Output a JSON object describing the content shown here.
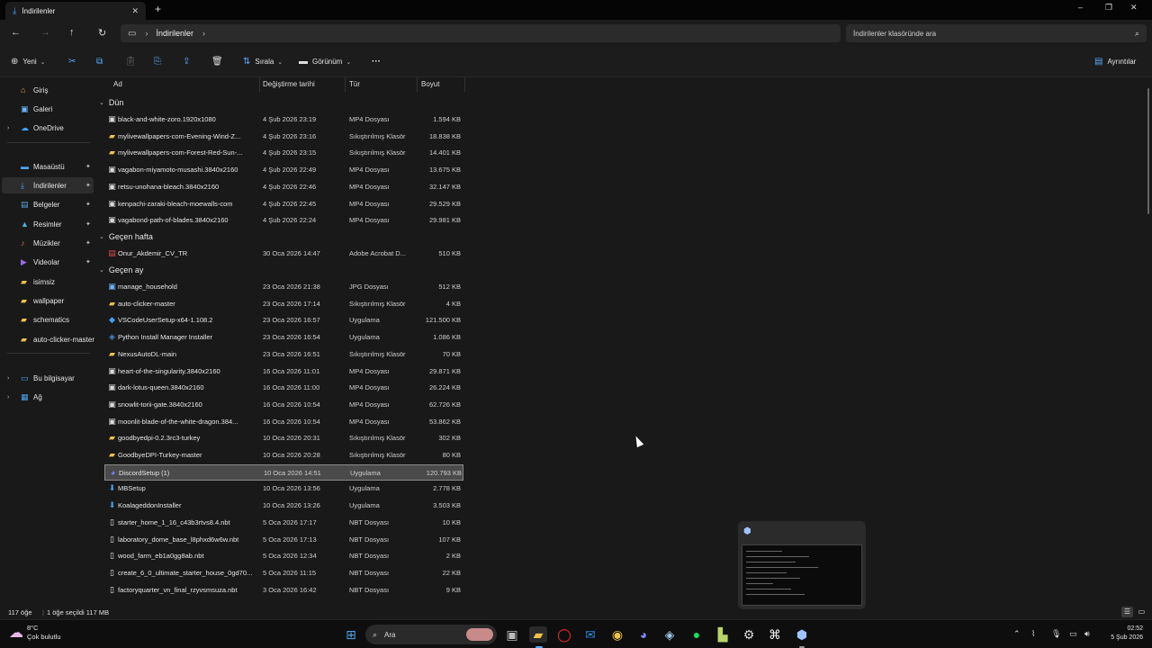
{
  "window": {
    "tab_title": "İndirilenler",
    "new_tab": "+",
    "controls": [
      "–",
      "❐",
      "✕"
    ]
  },
  "address": {
    "breadcrumbs": [
      "İndirilenler"
    ],
    "search_placeholder": "İndirilenler klasöründe ara"
  },
  "commands": {
    "new": "Yeni",
    "sort": "Sırala",
    "view": "Görünüm",
    "more": "···",
    "details": "Ayrıntılar"
  },
  "sidebar": {
    "items": [
      {
        "label": "Giriş",
        "icon": "home-icon",
        "expandable": false,
        "pinned": false
      },
      {
        "label": "Galeri",
        "icon": "gallery-icon",
        "expandable": false,
        "pinned": false
      },
      {
        "label": "OneDrive",
        "icon": "cloud-icon",
        "expandable": true,
        "pinned": false
      },
      {
        "label": "Masaüstü",
        "icon": "desktop-icon",
        "expandable": false,
        "pinned": true
      },
      {
        "label": "İndirilenler",
        "icon": "download-icon",
        "expandable": false,
        "pinned": true,
        "active": true
      },
      {
        "label": "Belgeler",
        "icon": "documents-icon",
        "expandable": false,
        "pinned": true
      },
      {
        "label": "Resimler",
        "icon": "pictures-icon",
        "expandable": false,
        "pinned": true
      },
      {
        "label": "Müzikler",
        "icon": "music-icon",
        "expandable": false,
        "pinned": true
      },
      {
        "label": "Videolar",
        "icon": "videos-icon",
        "expandable": false,
        "pinned": true
      },
      {
        "label": "isimsiz",
        "icon": "folder-icon",
        "expandable": false,
        "pinned": false
      },
      {
        "label": "wallpaper",
        "icon": "folder-icon",
        "expandable": false,
        "pinned": false
      },
      {
        "label": "schematics",
        "icon": "folder-icon",
        "expandable": false,
        "pinned": false
      },
      {
        "label": "auto-clicker-master",
        "icon": "folder-icon",
        "expandable": false,
        "pinned": false
      },
      {
        "label": "Bu bilgisayar",
        "icon": "computer-icon",
        "expandable": true,
        "pinned": false
      },
      {
        "label": "Ağ",
        "icon": "network-icon",
        "expandable": true,
        "pinned": false
      }
    ]
  },
  "columns": {
    "name": "Ad",
    "date": "Değiştirme tarihi",
    "type": "Tür",
    "size": "Boyut"
  },
  "groups": [
    "Dün",
    "Geçen hafta",
    "Geçen ay"
  ],
  "files": [
    {
      "name": "black-and-white-zoro.1920x1080",
      "date": "4 Şub 2026 23:19",
      "type": "MP4 Dosyası",
      "size": "1.594 KB",
      "icon": "video-file-icon"
    },
    {
      "name": "mylivewallpapers-com-Evening-Wind-Z...",
      "date": "4 Şub 2026 23:16",
      "type": "Sıkıştırılmış Klasör",
      "size": "18.838 KB",
      "icon": "zip-folder-icon"
    },
    {
      "name": "mylivewallpapers-com-Forest-Red-Sun-...",
      "date": "4 Şub 2026 23:15",
      "type": "Sıkıştırılmış Klasör",
      "size": "14.401 KB",
      "icon": "zip-folder-icon"
    },
    {
      "name": "vagabon-miyamoto-musashi.3840x2160",
      "date": "4 Şub 2026 22:49",
      "type": "MP4 Dosyası",
      "size": "13.675 KB",
      "icon": "video-file-icon"
    },
    {
      "name": "retsu-unohana-bleach.3840x2160",
      "date": "4 Şub 2026 22:46",
      "type": "MP4 Dosyası",
      "size": "32.147 KB",
      "icon": "video-file-icon"
    },
    {
      "name": "kenpachi-zaraki-bleach-moewalls-com",
      "date": "4 Şub 2026 22:45",
      "type": "MP4 Dosyası",
      "size": "29.529 KB",
      "icon": "video-file-icon"
    },
    {
      "name": "vagabond-path-of-blades.3840x2160",
      "date": "4 Şub 2026 22:24",
      "type": "MP4 Dosyası",
      "size": "29.981 KB",
      "icon": "video-file-icon"
    },
    {
      "name": "Onur_Akdemir_CV_TR",
      "date": "30 Oca 2026 14:47",
      "type": "Adobe Acrobat D...",
      "size": "510 KB",
      "icon": "pdf-file-icon"
    },
    {
      "name": "manage_household",
      "date": "23 Oca 2026 21:38",
      "type": "JPG Dosyası",
      "size": "512 KB",
      "icon": "image-file-icon"
    },
    {
      "name": "auto-clicker-master",
      "date": "23 Oca 2026 17:14",
      "type": "Sıkıştırılmış Klasör",
      "size": "4 KB",
      "icon": "zip-folder-icon"
    },
    {
      "name": "VSCodeUserSetup-x64-1.108.2",
      "date": "23 Oca 2026 16:57",
      "type": "Uygulama",
      "size": "121.500 KB",
      "icon": "vscode-icon"
    },
    {
      "name": "Python Install Manager Installer",
      "date": "23 Oca 2026 16:54",
      "type": "Uygulama",
      "size": "1.086 KB",
      "icon": "python-icon"
    },
    {
      "name": "NexusAutoDL-main",
      "date": "23 Oca 2026 16:51",
      "type": "Sıkıştırılmış Klasör",
      "size": "70 KB",
      "icon": "zip-folder-icon"
    },
    {
      "name": "heart-of-the-singularity.3840x2160",
      "date": "16 Oca 2026 11:01",
      "type": "MP4 Dosyası",
      "size": "29.871 KB",
      "icon": "video-file-icon"
    },
    {
      "name": "dark-lotus-queen.3840x2160",
      "date": "16 Oca 2026 11:00",
      "type": "MP4 Dosyası",
      "size": "26.224 KB",
      "icon": "video-file-icon"
    },
    {
      "name": "snowlit-torii-gate.3840x2160",
      "date": "16 Oca 2026 10:54",
      "type": "MP4 Dosyası",
      "size": "62.726 KB",
      "icon": "video-file-icon"
    },
    {
      "name": "moonlit-blade-of-the-white-dragon.384...",
      "date": "16 Oca 2026 10:54",
      "type": "MP4 Dosyası",
      "size": "53.862 KB",
      "icon": "video-file-icon"
    },
    {
      "name": "goodbyedpi-0.2.3rc3-turkey",
      "date": "10 Oca 2026 20:31",
      "type": "Sıkıştırılmış Klasör",
      "size": "302 KB",
      "icon": "zip-folder-icon"
    },
    {
      "name": "GoodbyeDPI-Turkey-master",
      "date": "10 Oca 2026 20:28",
      "type": "Sıkıştırılmış Klasör",
      "size": "80 KB",
      "icon": "zip-folder-icon"
    },
    {
      "name": "DiscordSetup (1)",
      "date": "10 Oca 2026 14:51",
      "type": "Uygulama",
      "size": "120.793 KB",
      "icon": "discord-icon",
      "selected": true
    },
    {
      "name": "MBSetup",
      "date": "10 Oca 2026 13:56",
      "type": "Uygulama",
      "size": "2.778 KB",
      "icon": "installer-icon"
    },
    {
      "name": "KoalageddonInstaller",
      "date": "10 Oca 2026 13:26",
      "type": "Uygulama",
      "size": "3.503 KB",
      "icon": "installer-icon"
    },
    {
      "name": "starter_home_1_16_c43b3rtvs8.4.nbt",
      "date": "5 Oca 2026 17:17",
      "type": "NBT Dosyası",
      "size": "10 KB",
      "icon": "file-icon"
    },
    {
      "name": "laboratory_dome_base_l8phxd6w6w.nbt",
      "date": "5 Oca 2026 17:13",
      "type": "NBT Dosyası",
      "size": "107 KB",
      "icon": "file-icon"
    },
    {
      "name": "wood_farm_eb1a0gg8ab.nbt",
      "date": "5 Oca 2026 12:34",
      "type": "NBT Dosyası",
      "size": "2 KB",
      "icon": "file-icon"
    },
    {
      "name": "create_6_0_ultimate_starter_house_0gd70...",
      "date": "5 Oca 2026 11:15",
      "type": "NBT Dosyası",
      "size": "22 KB",
      "icon": "file-icon"
    },
    {
      "name": "factoryquarter_vn_final_rzyvsmsuza.nbt",
      "date": "3 Oca 2026 16:42",
      "type": "NBT Dosyası",
      "size": "9 KB",
      "icon": "file-icon"
    }
  ],
  "status": {
    "count": "117 öğe",
    "selection": "1 öğe seçildi  117 MB"
  },
  "taskbar": {
    "temperature": "8°C",
    "weather": "Çok bulutlu",
    "search_label": "Ara",
    "time": "02:52",
    "date": "5 Şub 2026"
  }
}
